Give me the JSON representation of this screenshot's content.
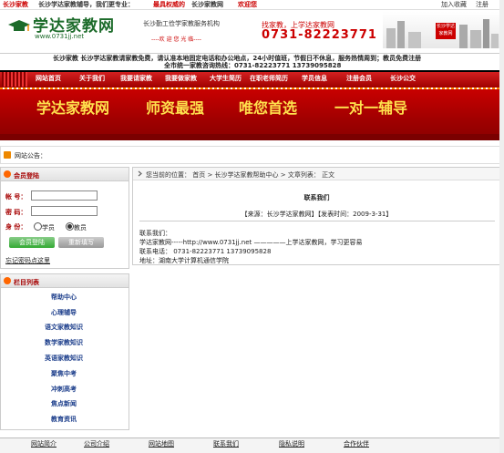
{
  "topbar": {
    "site": "长沙家教",
    "welcome": "长沙学达家教辅导，我们更专业：",
    "visit_prefix": "最具权威的",
    "visit_site": "长沙家教网",
    "visit_suffix": "欢迎您",
    "favorite": "加入收藏",
    "register": "注册"
  },
  "header": {
    "logo_text": "学达家教网",
    "logo_url": "www.0731jj.net",
    "slogan1": "长沙勤工俭学家教服务机构",
    "slogan2": "----欢 迎 您 光 临----",
    "phone_label": "找家教，上学达家教网",
    "phone": "0731-82223771",
    "sign_text": "长沙学达家教网"
  },
  "notice": {
    "line1": "长沙家教  长沙学达家教请家教免费，请认准本地固定电话和办公地点，24小时值班，节假日不休息，服务热情周到；教员免费注册",
    "line2": "全市统一家教咨询热线：0731-82223771  13739095828"
  },
  "nav": {
    "items": [
      "网站首页",
      "关于我们",
      "我要请家教",
      "我要做家教",
      "大学生简历",
      "在职老师简历",
      "学员信息",
      "注册会员",
      "长沙公交"
    ]
  },
  "banner": {
    "phrases": [
      "学达家教网",
      "师资最强",
      "唯您首选",
      "一对一辅导"
    ]
  },
  "announcement": {
    "label": "网站公告："
  },
  "login": {
    "title": "会员登陆",
    "account_label": "帐  号：",
    "password_label": "密  码：",
    "identity_label": "身  份：",
    "account_value": "",
    "password_value": "",
    "role_student": "学员",
    "role_teacher": "教员",
    "selected_role": "教员",
    "login_button": "会员登陆",
    "reset_button": "重新填写",
    "forgot": "忘记密码点这里"
  },
  "columns": {
    "title": "栏目列表",
    "items": [
      "帮助中心",
      "心理辅导",
      "语文家教知识",
      "数学家教知识",
      "英语家教知识",
      "聚焦中考",
      "冲刺高考",
      "焦点新闻",
      "教育资讯"
    ]
  },
  "article": {
    "breadcrumb": "您当前的位置：  首页  >  长沙学达家教帮助中心  >  文章列表：  正文",
    "title": "联系我们",
    "meta": "【来源：长沙学达家教网】【发表时间：2009-3-31】",
    "lines": [
      "联系我们：",
      "   学达家教网-----http://www.0731jj.net  —————上学达家教网，学习更容易",
      "联系电话：  0731-82223771   13739095828",
      "地址：湖南大学计算机通信学院"
    ]
  },
  "footer": {
    "links": [
      "网站简介",
      "公司介绍",
      "网站地图",
      "联系我们",
      "隐私说明",
      "合作伙伴"
    ]
  }
}
